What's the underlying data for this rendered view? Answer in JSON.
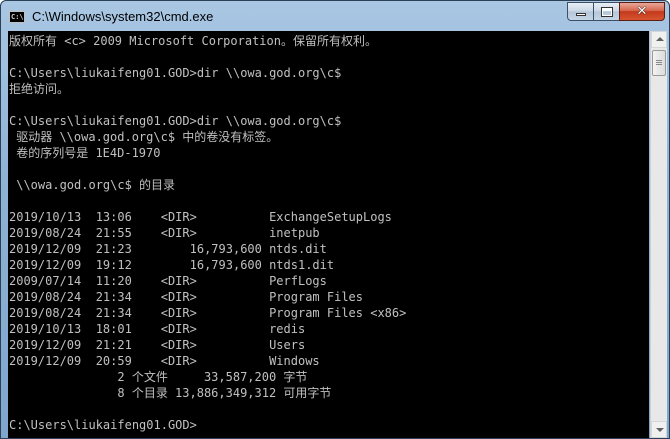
{
  "window": {
    "title": "C:\\Windows\\system32\\cmd.exe",
    "icon": "cmd-icon",
    "icon_label": "C:\\",
    "buttons": {
      "minimize": "minimize-icon",
      "maximize": "maximize-icon",
      "close": "close-icon",
      "close_glyph": "✕"
    }
  },
  "console": {
    "text_color": "#c0c0c0",
    "background": "#000000",
    "lines": [
      "版权所有 <c> 2009 Microsoft Corporation。保留所有权利。",
      "",
      "C:\\Users\\liukaifeng01.GOD>dir \\\\owa.god.org\\c$",
      "拒绝访问。",
      "",
      "C:\\Users\\liukaifeng01.GOD>dir \\\\owa.god.org\\c$",
      " 驱动器 \\\\owa.god.org\\c$ 中的卷没有标签。",
      " 卷的序列号是 1E4D-1970",
      "",
      " \\\\owa.god.org\\c$ 的目录",
      "",
      "2019/10/13  13:06    <DIR>          ExchangeSetupLogs",
      "2019/08/24  21:55    <DIR>          inetpub",
      "2019/12/09  21:23        16,793,600 ntds.dit",
      "2019/12/09  19:12        16,793,600 ntds1.dit",
      "2009/07/14  11:20    <DIR>          PerfLogs",
      "2019/08/24  21:34    <DIR>          Program Files",
      "2019/08/24  21:34    <DIR>          Program Files <x86>",
      "2019/10/13  18:01    <DIR>          redis",
      "2019/12/09  21:21    <DIR>          Users",
      "2019/12/09  20:59    <DIR>          Windows",
      "               2 个文件     33,587,200 字节",
      "               8 个目录 13,886,349,312 可用字节",
      "",
      "C:\\Users\\liukaifeng01.GOD>"
    ]
  },
  "scrollbar": {
    "up": "scroll-up-arrow-icon",
    "down": "scroll-down-arrow-icon"
  }
}
